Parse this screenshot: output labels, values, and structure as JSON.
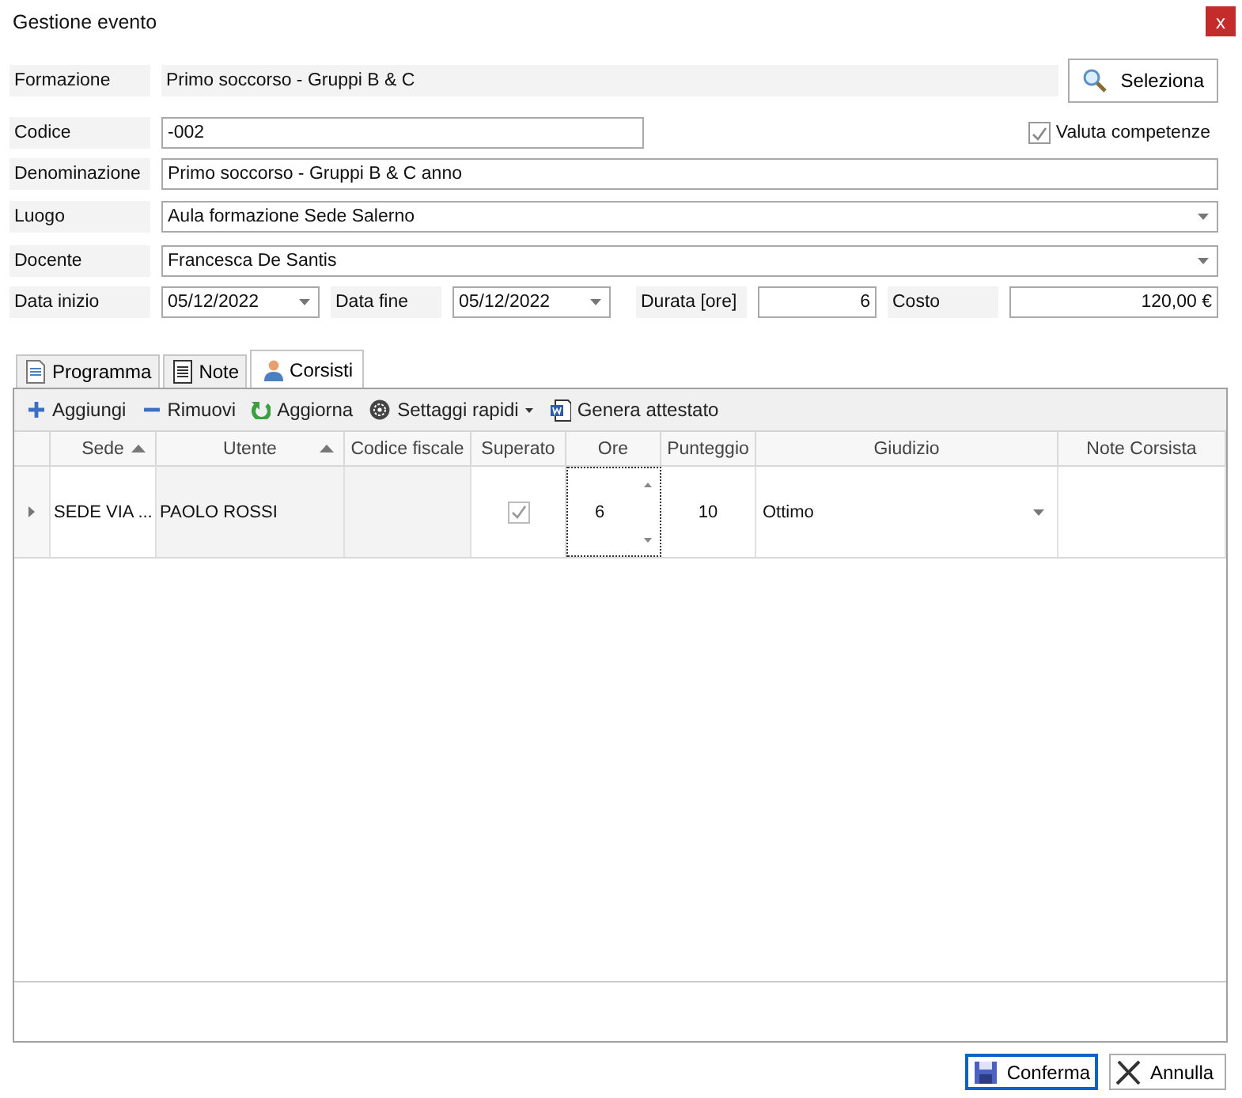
{
  "window": {
    "title": "Gestione evento",
    "close": "x"
  },
  "formazione": {
    "label": "Formazione",
    "value": "Primo soccorso - Gruppi B & C",
    "button": "Seleziona"
  },
  "codice": {
    "label": "Codice",
    "value": "-002"
  },
  "valuta_competenze": {
    "label": "Valuta competenze",
    "checked": true
  },
  "denominazione": {
    "label": "Denominazione",
    "value": "Primo soccorso - Gruppi B & C anno"
  },
  "luogo": {
    "label": "Luogo",
    "value": "Aula formazione Sede Salerno"
  },
  "docente": {
    "label": "Docente",
    "value": "Francesca De Santis"
  },
  "data_inizio": {
    "label": "Data inizio",
    "value": "05/12/2022"
  },
  "data_fine": {
    "label": "Data fine",
    "value": "05/12/2022"
  },
  "durata": {
    "label": "Durata [ore]",
    "value": "6"
  },
  "costo": {
    "label": "Costo",
    "value": "120,00 €"
  },
  "tabs": [
    {
      "label": "Programma",
      "selected": false
    },
    {
      "label": "Note",
      "selected": false
    },
    {
      "label": "Corsisti",
      "selected": true
    }
  ],
  "toolbar": [
    {
      "label": "Aggiungi",
      "has_menu": false
    },
    {
      "label": "Rimuovi",
      "has_menu": false
    },
    {
      "label": "Aggiorna",
      "has_menu": false
    },
    {
      "label": "Settaggi rapidi",
      "has_menu": true
    },
    {
      "label": "Genera attestato",
      "has_menu": false
    }
  ],
  "table": {
    "columns": [
      {
        "label": "Sede",
        "sorted": true
      },
      {
        "label": "Utente",
        "sorted": true
      },
      {
        "label": "Codice fiscale",
        "sorted": false
      },
      {
        "label": "Superato",
        "sorted": false
      },
      {
        "label": "Ore",
        "sorted": false
      },
      {
        "label": "Punteggio",
        "sorted": false
      },
      {
        "label": "Giudizio",
        "sorted": false
      },
      {
        "label": "Note Corsista",
        "sorted": false
      }
    ],
    "rows": [
      {
        "current": true,
        "sede": "SEDE VIA ...",
        "utente": "PAOLO ROSSI",
        "superato": true,
        "ore": "6",
        "punteggio": "10",
        "giudizio": "Ottimo"
      }
    ]
  },
  "buttons": [
    {
      "label": "Conferma",
      "default": true
    },
    {
      "label": "Annulla",
      "default": false
    }
  ]
}
